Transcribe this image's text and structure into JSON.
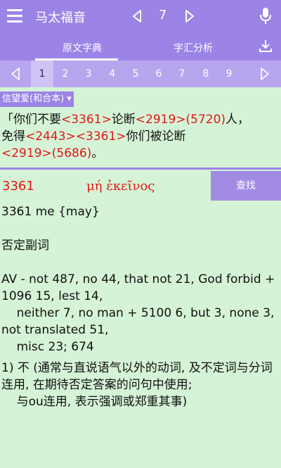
{
  "topbar": {
    "book_title": "马太福音",
    "chapter": "7"
  },
  "tabs": [
    {
      "label": "原文字典"
    },
    {
      "label": "字汇分析"
    }
  ],
  "verse_nav": {
    "numbers": [
      "1",
      "2",
      "3",
      "4",
      "5",
      "6",
      "7",
      "8",
      "9"
    ],
    "active": "1"
  },
  "version": {
    "label": "信望爱(和合本) ▾"
  },
  "verse": {
    "p1": "「你们不要",
    "r1": "<3361>",
    "p2": "论断",
    "r2": "<2919>(5720)",
    "p3": "人，",
    "p4": "免得",
    "r3": "<2443><3361>",
    "p5": "你们被论断",
    "r4": "<2919>(5686)",
    "p6": "。"
  },
  "lookup": {
    "strong_number": "3361",
    "greek": "μή ἐκεῖνος",
    "search_label": "查找"
  },
  "definition": {
    "line1": "3361 me {may}",
    "line2": "否定副词",
    "line3": "AV - not 487, no 44, that not 21, God forbid + 1096 15, lest 14,\n    neither 7, no man + 5100 6, but 3, none 3, not translated 51,\n    misc 23; 674",
    "line4": "1) 不 (通常与直说语气以外的动词, 及不定词与分词连用, 在期待否定答案的问句中使用;\n    与ou连用, 表示强调或郑重其事)"
  },
  "colors": {
    "accent": "#9b84e6",
    "background": "#d5f3d6",
    "reference": "#e01818"
  }
}
